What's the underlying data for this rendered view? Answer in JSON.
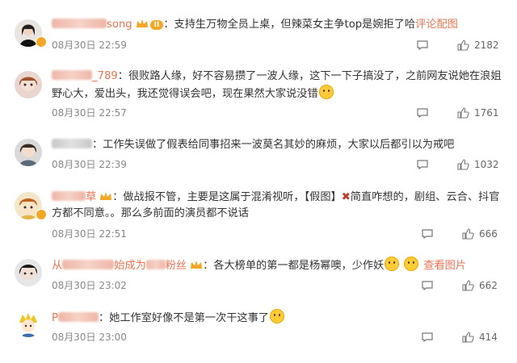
{
  "comments": [
    {
      "username": "song",
      "level_badge": "II",
      "text": "：支持生万物全员上桌，但辣菜女主争top是婉拒了哈",
      "link": "评论配图",
      "time": "08月30日 22:59",
      "likes": "2182"
    },
    {
      "username": "_789",
      "text": "：很败路人缘，好不容易攒了一波人缘，这下一下子搞没了，之前网友说她在浪姐野心大，爱出头，我还觉得误会吧，现在果然大家说没错",
      "time": "08月30日 22:57",
      "likes": "1761"
    },
    {
      "username": "",
      "text": "：工作失误做了假表给同事招来一波莫名其妙的麻烦，大家以后都引以为戒吧",
      "time": "08月30日 22:39",
      "likes": "1032"
    },
    {
      "username": "草",
      "text_before": "：做战报不管，主要是这属于混淆视听，【假图】",
      "text_after": "简直咋想的，剧组、云合、抖官方都不同意。。那么多前面的演员都不说话",
      "time": "08月30日 22:51",
      "likes": "666"
    },
    {
      "username_prefix": "从",
      "username_mid": "始成为",
      "username_suffix": "粉丝",
      "text": "：各大榜单的第一都是杨幂噢，少作妖",
      "link": "查看图片",
      "time": "08月30日 23:02",
      "likes": "662"
    },
    {
      "username_prefix": "P",
      "text": "：她工作室好像不是第一次干这事了",
      "time": "08月30日 23:00",
      "likes": "414"
    }
  ],
  "colors": {
    "username": "#eb7350",
    "meta": "#888888",
    "text": "#333333"
  },
  "icons": {
    "reply": "comment-icon",
    "like": "thumbs-up-icon"
  }
}
